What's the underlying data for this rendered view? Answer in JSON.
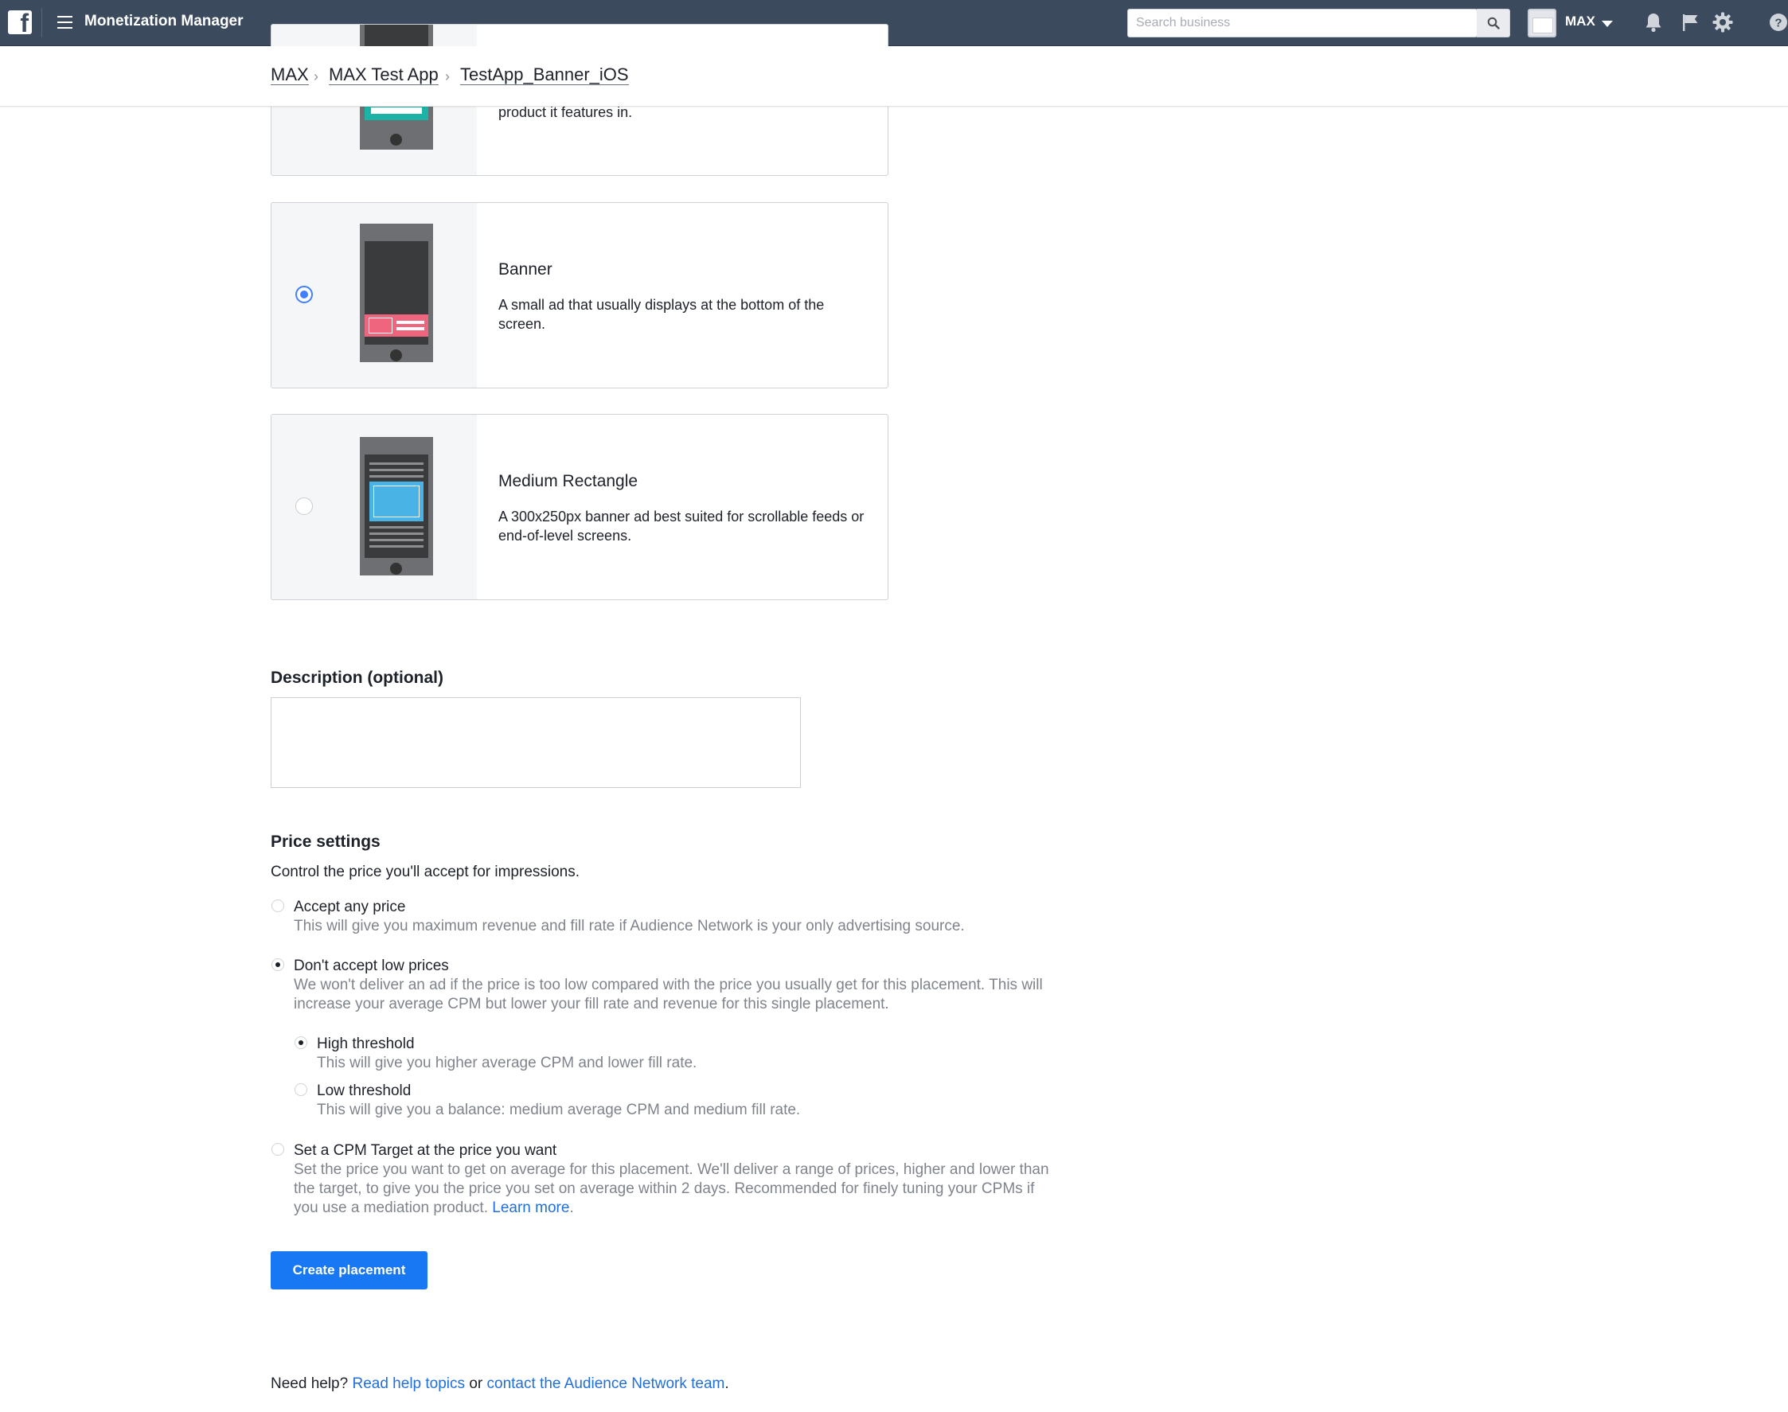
{
  "header": {
    "app_title": "Monetization Manager",
    "search_placeholder": "Search business",
    "business_name": "MAX"
  },
  "breadcrumb": [
    "MAX",
    "MAX Test App",
    "TestApp_Banner_iOS"
  ],
  "formats": [
    {
      "title": "",
      "desc": "product it features in.",
      "selected": false
    },
    {
      "title": "Banner",
      "desc": "A small ad that usually displays at the bottom of the screen.",
      "selected": true
    },
    {
      "title": "Medium Rectangle",
      "desc": "A 300x250px banner ad best suited for scrollable feeds or end-of-level screens.",
      "selected": false
    }
  ],
  "description": {
    "label": "Description (optional)",
    "value": ""
  },
  "price": {
    "heading": "Price settings",
    "subtitle": "Control the price you'll accept for impressions.",
    "options": [
      {
        "title": "Accept any price",
        "desc": "This will give you maximum revenue and fill rate if Audience Network is your only advertising source.",
        "selected": false
      },
      {
        "title": "Don't accept low prices",
        "desc": "We won't deliver an ad if the price is too low compared with the price you usually get for this placement. This will increase your average CPM but lower your fill rate and revenue for this single placement.",
        "selected": true
      },
      {
        "title": "Set a CPM Target at the price you want",
        "desc": "Set the price you want to get on average for this placement. We'll deliver a range of prices, higher and lower than the target, to give you the price you set on average within 2 days. Recommended for finely tuning your CPMs if you use a mediation product.",
        "link": "Learn more",
        "after_link": ".",
        "selected": false
      }
    ],
    "thresholds": [
      {
        "title": "High threshold",
        "desc": "This will give you higher average CPM and lower fill rate.",
        "selected": true
      },
      {
        "title": "Low threshold",
        "desc": "This will give you a balance: medium average CPM and medium fill rate.",
        "selected": false
      }
    ]
  },
  "create_button": "Create placement",
  "help": {
    "prefix": "Need help?",
    "link1": "Read help topics",
    "middle": "or",
    "link2": "contact the Audience Network team",
    "suffix": "."
  },
  "colors": {
    "topbar": "#3b4a5c",
    "primary": "#1877f2",
    "link": "#216fdb",
    "banner_ad": "#f0657e",
    "rect_ad": "#4ab3e6",
    "native_ad": "#1ab3a6"
  },
  "icons": [
    "facebook-logo-icon",
    "hamburger-menu-icon",
    "search-icon",
    "notifications-bell-icon",
    "flag-icon",
    "gear-icon",
    "help-icon"
  ]
}
